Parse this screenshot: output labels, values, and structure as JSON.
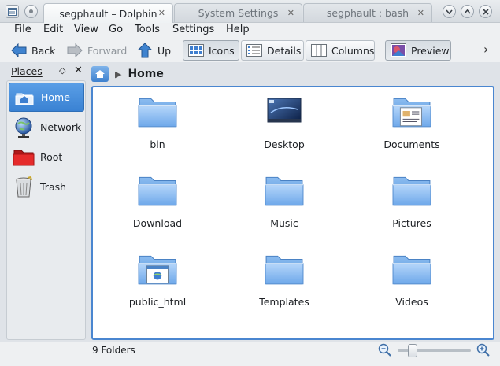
{
  "window": {
    "tabs": [
      {
        "label": "segphault – Dolphin",
        "active": true
      },
      {
        "label": "System Settings",
        "active": false
      },
      {
        "label": "segphault : bash",
        "active": false
      }
    ],
    "close_glyph": "✕",
    "controls": {
      "minimize": "chevron-down-icon",
      "maximize": "chevron-up-icon",
      "close": "close-icon"
    }
  },
  "menu": {
    "items": [
      "File",
      "Edit",
      "View",
      "Go",
      "Tools",
      "Settings",
      "Help"
    ]
  },
  "toolbar": {
    "back_label": "Back",
    "forward_label": "Forward",
    "up_label": "Up",
    "icons_label": "Icons",
    "details_label": "Details",
    "columns_label": "Columns",
    "preview_label": "Preview",
    "overflow_glyph": "›",
    "active_view": "Icons",
    "preview_checked": true
  },
  "places": {
    "title": "Places",
    "float_glyph": "◇",
    "close_glyph": "✕",
    "items": [
      {
        "label": "Home",
        "icon": "home-icon",
        "selected": true
      },
      {
        "label": "Network",
        "icon": "network-globe-icon",
        "selected": false
      },
      {
        "label": "Root",
        "icon": "red-folder-icon",
        "selected": false
      },
      {
        "label": "Trash",
        "icon": "trash-icon",
        "selected": false
      }
    ]
  },
  "breadcrumb": {
    "separator": "▶",
    "current": "Home"
  },
  "files": [
    {
      "name": "bin",
      "icon": "folder-icon"
    },
    {
      "name": "Desktop",
      "icon": "desktop-folder-icon"
    },
    {
      "name": "Documents",
      "icon": "documents-folder-icon"
    },
    {
      "name": "Download",
      "icon": "folder-icon"
    },
    {
      "name": "Music",
      "icon": "folder-icon"
    },
    {
      "name": "Pictures",
      "icon": "folder-icon"
    },
    {
      "name": "public_html",
      "icon": "html-folder-icon"
    },
    {
      "name": "Templates",
      "icon": "folder-icon"
    },
    {
      "name": "Videos",
      "icon": "folder-icon"
    }
  ],
  "status": {
    "text": "9 Folders",
    "zoom_level": 0.16
  },
  "colors": {
    "accent": "#3a82d3",
    "folder": "#7fb0ea",
    "selection_border": "#4a86d0"
  }
}
